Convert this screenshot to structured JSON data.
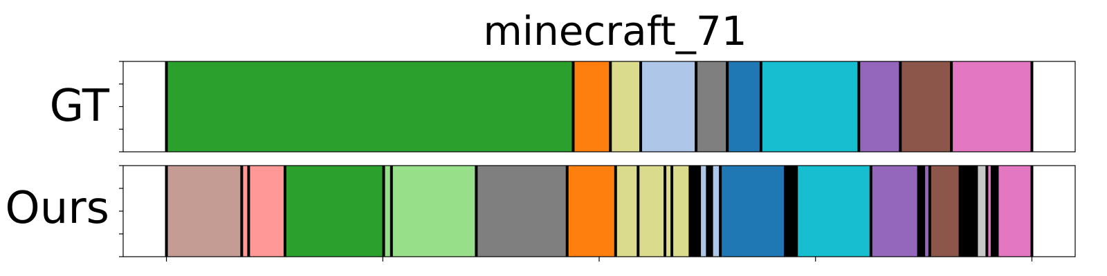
{
  "chart_data": {
    "type": "segmentation-timeline",
    "title": "minecraft_71",
    "rows": [
      {
        "label": "GT",
        "segments": [
          {
            "start": 0.0,
            "end": 0.05,
            "color": "#ffffff"
          },
          {
            "start": 0.05,
            "end": 0.52,
            "color": "#2ca02c"
          },
          {
            "start": 0.52,
            "end": 0.563,
            "color": "#ff7f0e"
          },
          {
            "start": 0.563,
            "end": 0.598,
            "color": "#dbdb8d"
          },
          {
            "start": 0.598,
            "end": 0.662,
            "color": "#aec7e8"
          },
          {
            "start": 0.662,
            "end": 0.698,
            "color": "#7f7f7f"
          },
          {
            "start": 0.698,
            "end": 0.737,
            "color": "#1f77b4"
          },
          {
            "start": 0.737,
            "end": 0.85,
            "color": "#17becf"
          },
          {
            "start": 0.85,
            "end": 0.898,
            "color": "#9467bd"
          },
          {
            "start": 0.898,
            "end": 0.957,
            "color": "#8c564b"
          },
          {
            "start": 0.957,
            "end": 1.05,
            "color": "#e377c2"
          },
          {
            "start": 1.05,
            "end": 1.1,
            "color": "#ffffff"
          }
        ]
      },
      {
        "label": "Ours",
        "segments": [
          {
            "start": 0.0,
            "end": 0.05,
            "color": "#ffffff"
          },
          {
            "start": 0.05,
            "end": 0.137,
            "color": "#c49c94"
          },
          {
            "start": 0.137,
            "end": 0.145,
            "color": "#ff9896"
          },
          {
            "start": 0.145,
            "end": 0.187,
            "color": "#ff9896"
          },
          {
            "start": 0.187,
            "end": 0.301,
            "color": "#2ca02c"
          },
          {
            "start": 0.301,
            "end": 0.31,
            "color": "#98df8a"
          },
          {
            "start": 0.31,
            "end": 0.408,
            "color": "#98df8a"
          },
          {
            "start": 0.408,
            "end": 0.513,
            "color": "#7f7f7f"
          },
          {
            "start": 0.513,
            "end": 0.569,
            "color": "#ff7f0e"
          },
          {
            "start": 0.569,
            "end": 0.595,
            "color": "#dbdb8d"
          },
          {
            "start": 0.595,
            "end": 0.626,
            "color": "#dbdb8d"
          },
          {
            "start": 0.626,
            "end": 0.634,
            "color": "#dbdb8d"
          },
          {
            "start": 0.634,
            "end": 0.655,
            "color": "#dbdb8d"
          },
          {
            "start": 0.655,
            "end": 0.666,
            "color": "#000000"
          },
          {
            "start": 0.666,
            "end": 0.675,
            "color": "#aec7e8"
          },
          {
            "start": 0.675,
            "end": 0.68,
            "color": "#000000"
          },
          {
            "start": 0.68,
            "end": 0.69,
            "color": "#aec7e8"
          },
          {
            "start": 0.69,
            "end": 0.765,
            "color": "#1f77b4"
          },
          {
            "start": 0.765,
            "end": 0.778,
            "color": "#000000"
          },
          {
            "start": 0.778,
            "end": 0.864,
            "color": "#17becf"
          },
          {
            "start": 0.864,
            "end": 0.919,
            "color": "#9467bd"
          },
          {
            "start": 0.919,
            "end": 0.925,
            "color": "#000000"
          },
          {
            "start": 0.925,
            "end": 0.932,
            "color": "#9467bd"
          },
          {
            "start": 0.932,
            "end": 0.967,
            "color": "#8c564b"
          },
          {
            "start": 0.967,
            "end": 0.986,
            "color": "#000000"
          },
          {
            "start": 0.986,
            "end": 0.998,
            "color": "#c7c7c7"
          },
          {
            "start": 0.998,
            "end": 1.004,
            "color": "#e377c2"
          },
          {
            "start": 1.004,
            "end": 1.01,
            "color": "#000000"
          },
          {
            "start": 1.01,
            "end": 1.05,
            "color": "#e377c2"
          },
          {
            "start": 1.05,
            "end": 1.1,
            "color": "#ffffff"
          }
        ]
      }
    ],
    "xlim": [
      0,
      1.1
    ],
    "grid": false,
    "legend": "none"
  }
}
